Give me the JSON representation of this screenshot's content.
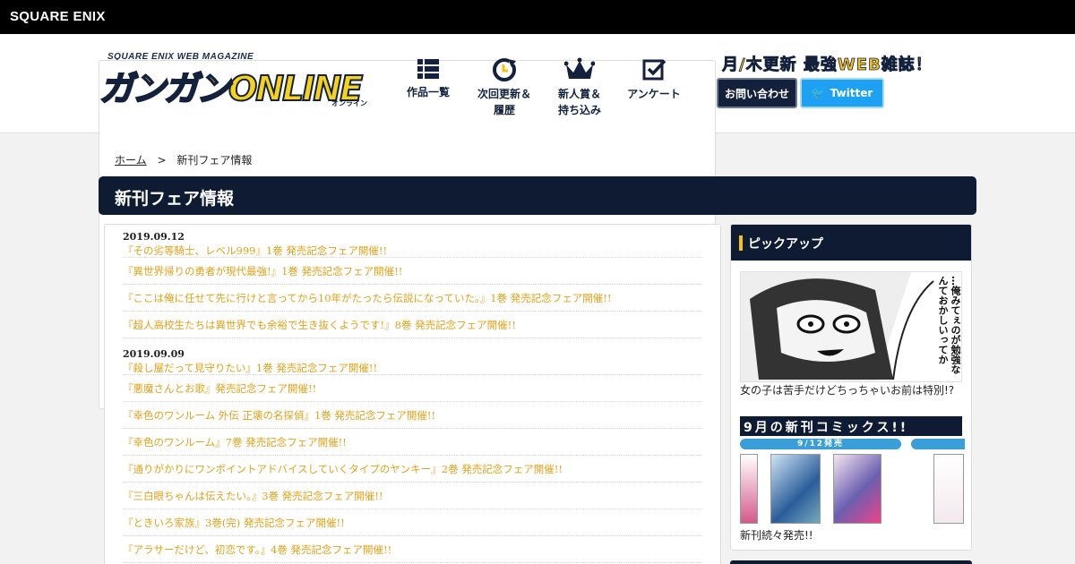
{
  "topbar": {
    "brand": "SQUARE ENIX"
  },
  "logo": {
    "sub": "SQUARE ENIX WEB MAGAZINE",
    "main": "ガンガンONLINE",
    "kana": "オンライン"
  },
  "nav": [
    {
      "label1": "作品一覧",
      "label2": "",
      "icon": "grid-list-icon"
    },
    {
      "label1": "次回更新＆",
      "label2": "履歴",
      "icon": "refresh-clock-icon"
    },
    {
      "label1": "新人賞＆",
      "label2": "持ち込み",
      "icon": "crown-icon"
    },
    {
      "label1": "アンケート",
      "label2": "",
      "icon": "checkbox-icon"
    }
  ],
  "header": {
    "catch": "月/木更新 最強WEB雑誌！",
    "contact": "お問い合わせ",
    "twitter": "Twitter"
  },
  "breadcrumb": {
    "home": "ホーム",
    "sep": ">",
    "current": "新刊フェア情報"
  },
  "page_title": "新刊フェア情報",
  "groups": [
    {
      "date": "2019.09.12",
      "items": [
        "『その劣等騎士、レベル999』1巻 発売記念フェア開催!!",
        "『異世界帰りの勇者が現代最強!』1巻 発売記念フェア開催!!",
        "『ここは俺に任せて先に行けと言ってから10年がたったら伝説になっていた。』1巻 発売記念フェア開催!!",
        "『超人高校生たちは異世界でも余裕で生き抜くようです!』8巻 発売記念フェア開催!!"
      ]
    },
    {
      "date": "2019.09.09",
      "items": [
        "『殺し屋だって見守りたい』1巻 発売記念フェア開催!!",
        "『悪魔さんとお歌』発売記念フェア開催!!",
        "『幸色のワンルーム 外伝 正壊の名探偵』1巻 発売記念フェア開催!!",
        "『幸色のワンルーム』7巻 発売記念フェア開催!!",
        "『通りがかりにワンポイントアドバイスしていくタイプのヤンキー』2巻 発売記念フェア開催!!",
        "『三白眼ちゃんは伝えたい。』3巻 発売記念フェア開催!!",
        "『ときいろ家族』3巻(完) 発売記念フェア開催!!",
        "『アラサーだけど、初恋です。』4巻 発売記念フェア開催!!"
      ]
    }
  ],
  "sidebar": {
    "heading": "ピックアップ",
    "pickup_speech": "…俺みてぇのが勉強なんておかしいってか",
    "pickup_caption": "女の子は苦手だけどちっちゃいお前は特別!?",
    "banner_title": "9月の新刊コミックス!!",
    "banner_date": "9/12発売",
    "banner_caption": "新刊続々発売!!"
  },
  "colors": {
    "navy": "#0e1b33",
    "link": "#e0a21a",
    "accent": "#f6c01b",
    "twitter": "#1da1f2"
  }
}
